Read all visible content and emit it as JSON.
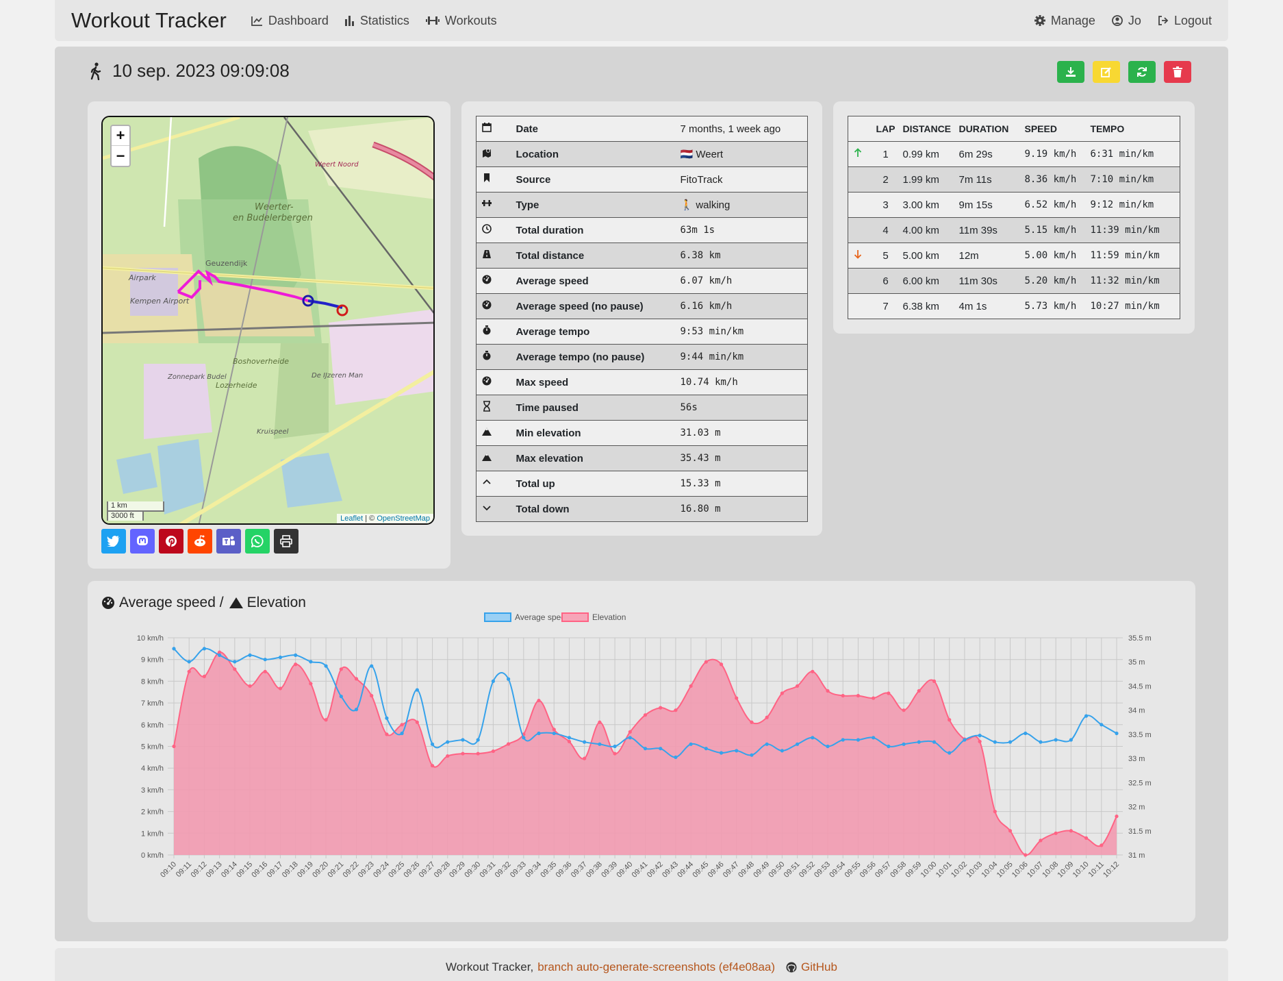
{
  "navbar": {
    "brand": "Workout Tracker",
    "items": [
      "Dashboard",
      "Statistics",
      "Workouts"
    ],
    "right_items": [
      "Manage",
      "Jo",
      "Logout"
    ]
  },
  "workout": {
    "title": "10 sep. 2023 09:09:08"
  },
  "map": {
    "zoom_in": "+",
    "zoom_out": "−",
    "scale_km": "1 km",
    "scale_ft": "3000 ft",
    "attribution_leaflet": "Leaflet",
    "attribution_osm": "OpenStreetMap",
    "labels": [
      "Weerter-",
      "en Budelerbergen",
      "Geuzendijk",
      "Airpark",
      "Kempen Airport",
      "Boshoverheide",
      "Lozerheide",
      "Zonnepark Budel",
      "De IJzeren Man",
      "Kruispeel",
      "Weert Noord"
    ]
  },
  "details": [
    {
      "icon": "calendar-icon",
      "label": "Date",
      "value": "7 months, 1 week ago",
      "mono": false
    },
    {
      "icon": "map-location-icon",
      "label": "Location",
      "value": "🇳🇱 Weert",
      "mono": false
    },
    {
      "icon": "bookmark-icon",
      "label": "Source",
      "value": "FitoTrack",
      "mono": false
    },
    {
      "icon": "dumbbell-icon",
      "label": "Type",
      "value": "🚶 walking",
      "mono": false
    },
    {
      "icon": "clock-icon",
      "label": "Total duration",
      "value": "63m 1s",
      "mono": true
    },
    {
      "icon": "road-icon",
      "label": "Total distance",
      "value": "6.38 km",
      "mono": true
    },
    {
      "icon": "gauge-icon",
      "label": "Average speed",
      "value": "6.07 km/h",
      "mono": true
    },
    {
      "icon": "gauge-icon",
      "label": "Average speed (no pause)",
      "value": "6.16 km/h",
      "mono": true
    },
    {
      "icon": "stopwatch-icon",
      "label": "Average tempo",
      "value": "9:53 min/km",
      "mono": true
    },
    {
      "icon": "stopwatch-icon",
      "label": "Average tempo (no pause)",
      "value": "9:44 min/km",
      "mono": true
    },
    {
      "icon": "gauge-icon",
      "label": "Max speed",
      "value": "10.74 km/h",
      "mono": true
    },
    {
      "icon": "hourglass-icon",
      "label": "Time paused",
      "value": "56s",
      "mono": true
    },
    {
      "icon": "mountain-icon",
      "label": "Min elevation",
      "value": "31.03 m",
      "mono": true
    },
    {
      "icon": "mountain-icon",
      "label": "Max elevation",
      "value": "35.43 m",
      "mono": true
    },
    {
      "icon": "chevron-up-icon",
      "label": "Total up",
      "value": "15.33 m",
      "mono": true
    },
    {
      "icon": "chevron-down-icon",
      "label": "Total down",
      "value": "16.80 m",
      "mono": true
    }
  ],
  "laps": {
    "headers": [
      "LAP",
      "DISTANCE",
      "DURATION",
      "SPEED",
      "TEMPO"
    ],
    "rows": [
      {
        "marker": "up",
        "lap": "1",
        "distance": "0.99 km",
        "duration": "6m 29s",
        "speed": "9.19 km/h",
        "tempo": "6:31 min/km"
      },
      {
        "marker": "",
        "lap": "2",
        "distance": "1.99 km",
        "duration": "7m 11s",
        "speed": "8.36 km/h",
        "tempo": "7:10 min/km"
      },
      {
        "marker": "",
        "lap": "3",
        "distance": "3.00 km",
        "duration": "9m 15s",
        "speed": "6.52 km/h",
        "tempo": "9:12 min/km"
      },
      {
        "marker": "",
        "lap": "4",
        "distance": "4.00 km",
        "duration": "11m 39s",
        "speed": "5.15 km/h",
        "tempo": "11:39 min/km"
      },
      {
        "marker": "down",
        "lap": "5",
        "distance": "5.00 km",
        "duration": "12m",
        "speed": "5.00 km/h",
        "tempo": "11:59 min/km"
      },
      {
        "marker": "",
        "lap": "6",
        "distance": "6.00 km",
        "duration": "11m 30s",
        "speed": "5.20 km/h",
        "tempo": "11:32 min/km"
      },
      {
        "marker": "",
        "lap": "7",
        "distance": "6.38 km",
        "duration": "4m 1s",
        "speed": "5.73 km/h",
        "tempo": "10:27 min/km"
      }
    ]
  },
  "chart_section": {
    "title_speed": "Average speed /",
    "title_elevation": "Elevation"
  },
  "chart_data": {
    "type": "line",
    "x": [
      "09:10",
      "09:11",
      "09:12",
      "09:13",
      "09:14",
      "09:15",
      "09:16",
      "09:17",
      "09:18",
      "09:19",
      "09:20",
      "09:21",
      "09:22",
      "09:23",
      "09:24",
      "09:25",
      "09:26",
      "09:27",
      "09:28",
      "09:29",
      "09:30",
      "09:31",
      "09:32",
      "09:33",
      "09:34",
      "09:35",
      "09:36",
      "09:37",
      "09:38",
      "09:39",
      "09:40",
      "09:41",
      "09:42",
      "09:43",
      "09:44",
      "09:45",
      "09:46",
      "09:47",
      "09:48",
      "09:49",
      "09:50",
      "09:51",
      "09:52",
      "09:53",
      "09:54",
      "09:55",
      "09:56",
      "09:57",
      "09:58",
      "09:59",
      "10:00",
      "10:01",
      "10:02",
      "10:03",
      "10:04",
      "10:05",
      "10:06",
      "10:07",
      "10:08",
      "10:09",
      "10:10",
      "10:11",
      "10:12"
    ],
    "series": [
      {
        "name": "Average speed",
        "axis": "left",
        "unit": "km/h",
        "color": "#36a2eb",
        "fill": false,
        "values": [
          9.5,
          8.9,
          9.5,
          9.2,
          8.9,
          9.2,
          9.0,
          9.1,
          9.2,
          8.9,
          8.7,
          7.3,
          6.7,
          8.7,
          6.3,
          5.6,
          7.6,
          5.1,
          5.2,
          5.3,
          5.3,
          8.0,
          8.1,
          5.4,
          5.6,
          5.6,
          5.4,
          5.2,
          5.1,
          5.0,
          5.4,
          4.9,
          4.9,
          4.5,
          5.1,
          4.9,
          4.7,
          4.8,
          4.6,
          5.1,
          4.8,
          5.1,
          5.4,
          5.0,
          5.3,
          5.3,
          5.4,
          5.0,
          5.1,
          5.2,
          5.2,
          4.7,
          5.3,
          5.5,
          5.2,
          5.2,
          5.6,
          5.2,
          5.3,
          5.3,
          6.4,
          6.0,
          5.6
        ]
      },
      {
        "name": "Elevation",
        "axis": "right",
        "unit": "m",
        "color": "#ff6384",
        "fill": true,
        "values": [
          33.25,
          34.8,
          34.7,
          35.2,
          34.85,
          34.5,
          34.8,
          34.45,
          34.95,
          34.55,
          33.8,
          34.85,
          34.65,
          34.3,
          33.5,
          33.7,
          33.75,
          32.85,
          33.05,
          33.1,
          33.1,
          33.15,
          33.3,
          33.5,
          34.2,
          33.6,
          33.35,
          33.0,
          33.75,
          33.1,
          33.55,
          33.9,
          34.05,
          34.0,
          34.5,
          35.0,
          34.95,
          34.25,
          33.75,
          33.85,
          34.35,
          34.5,
          34.8,
          34.4,
          34.3,
          34.3,
          34.25,
          34.35,
          34.0,
          34.4,
          34.6,
          33.8,
          33.4,
          33.35,
          31.9,
          31.5,
          31.0,
          31.3,
          31.45,
          31.5,
          31.35,
          31.2,
          31.8
        ]
      }
    ],
    "left_axis": {
      "unit": "km/h",
      "min": 0,
      "max": 10,
      "ticks": [
        "0 km/h",
        "1 km/h",
        "2 km/h",
        "3 km/h",
        "4 km/h",
        "5 km/h",
        "6 km/h",
        "7 km/h",
        "8 km/h",
        "9 km/h",
        "10 km/h"
      ]
    },
    "right_axis": {
      "unit": "m",
      "min": 31,
      "max": 35.5,
      "ticks": [
        "31 m",
        "31.5 m",
        "32 m",
        "32.5 m",
        "33 m",
        "33.5 m",
        "34 m",
        "34.5 m",
        "35 m",
        "35.5 m"
      ]
    },
    "legend": {
      "placement": "top-center",
      "items": [
        "Average speed",
        "Elevation"
      ]
    },
    "grid": true
  },
  "footer": {
    "text": "Workout Tracker,",
    "branch": "branch auto-generate-screenshots (ef4e08aa)",
    "github": "GitHub"
  }
}
